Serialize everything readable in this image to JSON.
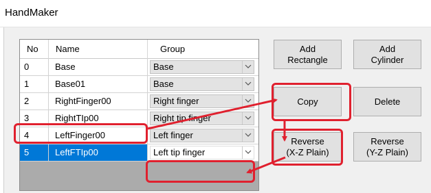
{
  "window": {
    "title": "HandMaker"
  },
  "grid": {
    "columns": [
      "No",
      "Name",
      "Group"
    ],
    "rows": [
      {
        "no": "0",
        "name": "Base",
        "group": "Base"
      },
      {
        "no": "1",
        "name": "Base01",
        "group": "Base"
      },
      {
        "no": "2",
        "name": "RightFinger00",
        "group": "Right finger"
      },
      {
        "no": "3",
        "name": "RightTIp00",
        "group": "Right tip finger"
      },
      {
        "no": "4",
        "name": "LeftFinger00",
        "group": "Left finger"
      },
      {
        "no": "5",
        "name": "LeftFTIp00",
        "group": "Left tip finger"
      }
    ]
  },
  "buttons": {
    "add_rectangle": [
      "Add",
      "Rectangle"
    ],
    "add_cylinder": [
      "Add",
      "Cylinder"
    ],
    "copy": "Copy",
    "delete": "Delete",
    "reverse_xz": [
      "Reverse",
      "(X-Z Plain)"
    ],
    "reverse_yz": [
      "Reverse",
      "(Y-Z Plain)"
    ]
  },
  "colors": {
    "selection": "#0078d7",
    "annotation": "#e0202e"
  }
}
